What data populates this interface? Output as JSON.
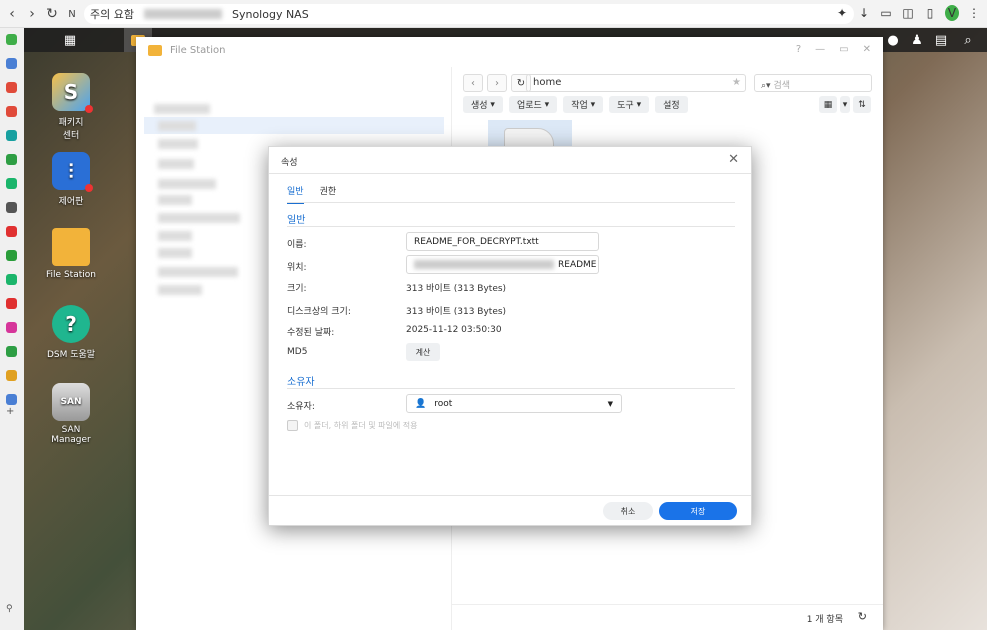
{
  "browser": {
    "warning_label": "주의 요함",
    "tab_title": "Synology NAS"
  },
  "desktop": {
    "icons": [
      {
        "label": "패키지\n센터"
      },
      {
        "label": "제어판"
      },
      {
        "label": "File Station"
      },
      {
        "label": "DSM 도움말"
      },
      {
        "label": "SAN Manager"
      }
    ]
  },
  "file_station": {
    "title": "File Station",
    "path": "home",
    "search_placeholder": "검색",
    "toolbar": {
      "create": "생성",
      "upload": "업로드",
      "action": "작업",
      "tools": "도구",
      "settings": "설정"
    },
    "status_count": "1 개 항목"
  },
  "dialog": {
    "title": "속성",
    "tabs": [
      "일반",
      "권한"
    ],
    "general_section": "일반",
    "fields": {
      "name_label": "이름:",
      "name_value": "README_FOR_DECRYPT.txtt",
      "location_label": "위치:",
      "location_value": "README",
      "size_label": "크기:",
      "size_value": "313 바이트 (313 Bytes)",
      "disk_size_label": "디스크상의 크기:",
      "disk_size_value": "313 바이트 (313 Bytes)",
      "modified_label": "수정된 날짜:",
      "modified_value": "2025-11-12 03:50:30",
      "md5_label": "MD5",
      "md5_button": "계산"
    },
    "owner_section": "소유자",
    "owner_label": "소유자:",
    "owner_value": "root",
    "apply_checkbox": "이 폴더, 하위 폴더 및 파일에 적용",
    "cancel": "취소",
    "save": "저장"
  },
  "colors": {
    "accent": "#1a73e8",
    "folder": "#f2b33a"
  }
}
